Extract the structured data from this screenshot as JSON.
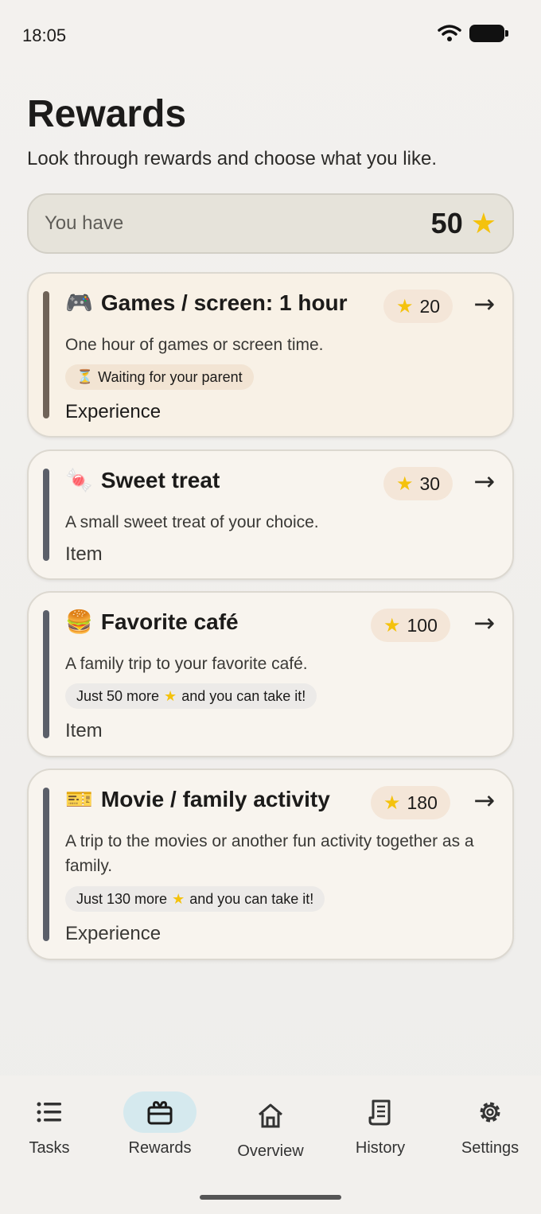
{
  "status": {
    "time": "18:05"
  },
  "header": {
    "title": "Rewards",
    "subtitle": "Look through rewards and choose what you like."
  },
  "balance": {
    "label": "You have",
    "value": "50",
    "icon": "star-icon"
  },
  "rewards": [
    {
      "emoji": "🎮",
      "title": "Games / screen: 1 hour",
      "price": "20",
      "description": "One hour of games or screen time.",
      "status_icon": "⏳",
      "status": "Waiting for your parent",
      "kind": "Experience"
    },
    {
      "emoji": "🍬",
      "title": "Sweet treat",
      "price": "30",
      "description": "A small sweet treat of your choice.",
      "kind": "Item"
    },
    {
      "emoji": "🍔",
      "title": "Favorite café",
      "price": "100",
      "description": "A family trip to your favorite café.",
      "hint_before": "Just 50 more",
      "hint_after": "and you can take it!",
      "kind": "Item"
    },
    {
      "emoji": "🎫",
      "title": "Movie / family activity",
      "price": "180",
      "description": "A trip to the movies or another fun activity together as a family.",
      "hint_before": "Just 130 more",
      "hint_after": "and you can take it!",
      "kind": "Experience"
    }
  ],
  "nav": [
    {
      "label": "Tasks",
      "icon": "list-icon",
      "active": false
    },
    {
      "label": "Rewards",
      "icon": "gift-icon",
      "active": true
    },
    {
      "label": "Overview",
      "icon": "home-icon",
      "active": false
    },
    {
      "label": "History",
      "icon": "receipt-icon",
      "active": false
    },
    {
      "label": "Settings",
      "icon": "gear-icon",
      "active": false
    }
  ],
  "colors": {
    "star": "#f4c20d",
    "active_nav": "#d5e9ee",
    "card_bar": "#5b5f69"
  }
}
